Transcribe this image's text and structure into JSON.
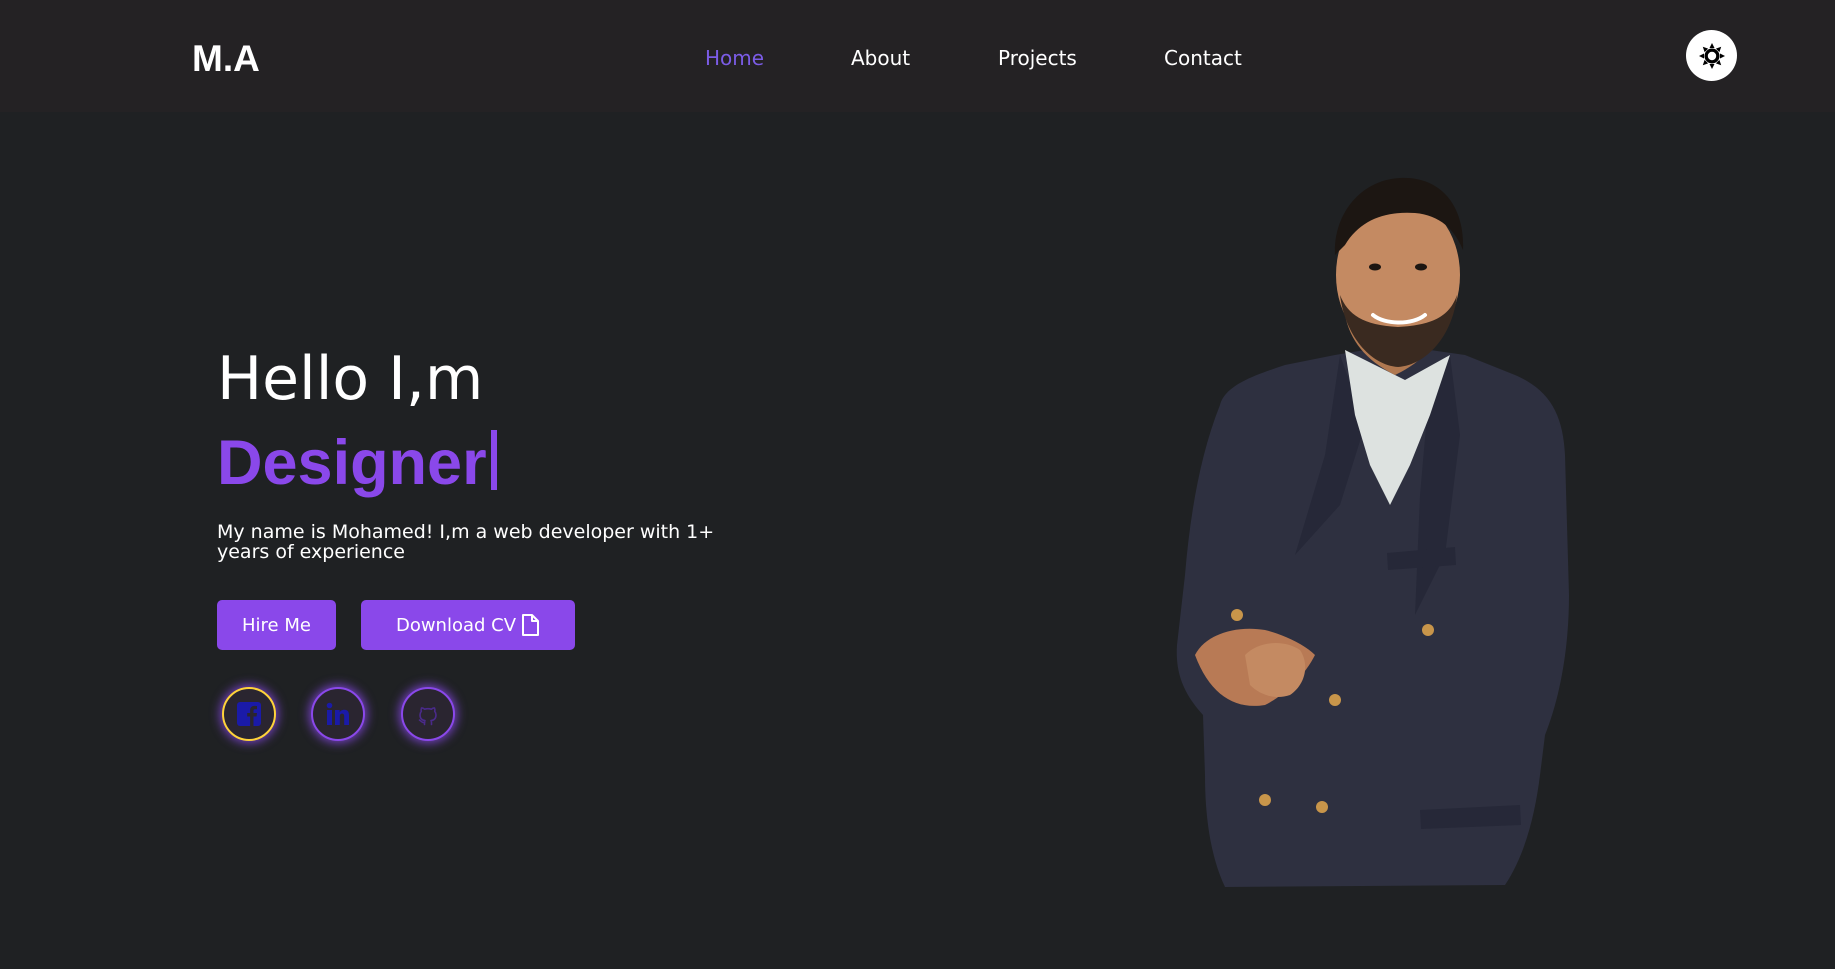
{
  "header": {
    "logo": "M.A",
    "nav": [
      {
        "label": "Home",
        "active": true
      },
      {
        "label": "About",
        "active": false
      },
      {
        "label": "Projects",
        "active": false
      },
      {
        "label": "Contact",
        "active": false
      }
    ],
    "theme_toggle_icon": "sun-icon"
  },
  "hero": {
    "greeting": "Hello I,m",
    "role": "Designer",
    "bio": "My name is Mohamed! I,m a web developer with 1+ years of experience",
    "buttons": {
      "hire": "Hire Me",
      "download_cv": "Download CV",
      "download_icon": "file-icon"
    },
    "social": [
      {
        "icon": "facebook-icon"
      },
      {
        "icon": "linkedin-icon"
      },
      {
        "icon": "github-icon"
      }
    ],
    "portrait_icon": "portrait-photo"
  },
  "colors": {
    "background": "#1f2123",
    "navbar": "#242224",
    "accent": "#8a48ea",
    "active_nav": "#7b5ce6",
    "social_icon": "#1a1aa8",
    "text": "#ffffff"
  }
}
